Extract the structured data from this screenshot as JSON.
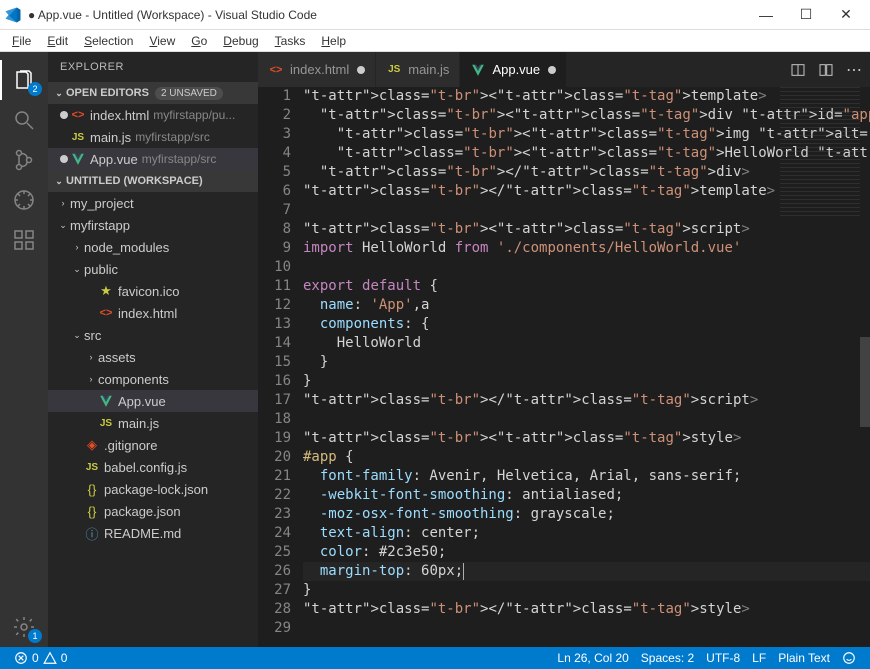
{
  "window": {
    "title": "● App.vue - Untitled (Workspace) - Visual Studio Code"
  },
  "menu": [
    "File",
    "Edit",
    "Selection",
    "View",
    "Go",
    "Debug",
    "Tasks",
    "Help"
  ],
  "activity_badges": {
    "explorer": "2",
    "settings": "1"
  },
  "sidebar": {
    "title": "EXPLORER",
    "open_editors": {
      "label": "OPEN EDITORS",
      "unsaved_badge": "2 UNSAVED",
      "items": [
        {
          "modified": true,
          "icon": "html",
          "name": "index.html",
          "desc": "myfirstapp/pu..."
        },
        {
          "modified": false,
          "icon": "js",
          "name": "main.js",
          "desc": "myfirstapp/src"
        },
        {
          "modified": true,
          "icon": "vue",
          "name": "App.vue",
          "desc": "myfirstapp/src"
        }
      ]
    },
    "workspace": {
      "label": "UNTITLED (WORKSPACE)",
      "tree": [
        {
          "depth": 0,
          "tw": "›",
          "icon": "",
          "name": "my_project"
        },
        {
          "depth": 0,
          "tw": "⌄",
          "icon": "",
          "name": "myfirstapp"
        },
        {
          "depth": 1,
          "tw": "›",
          "icon": "",
          "name": "node_modules"
        },
        {
          "depth": 1,
          "tw": "⌄",
          "icon": "",
          "name": "public"
        },
        {
          "depth": 2,
          "tw": "",
          "icon": "star",
          "name": "favicon.ico"
        },
        {
          "depth": 2,
          "tw": "",
          "icon": "html",
          "name": "index.html"
        },
        {
          "depth": 1,
          "tw": "⌄",
          "icon": "",
          "name": "src"
        },
        {
          "depth": 2,
          "tw": "›",
          "icon": "",
          "name": "assets"
        },
        {
          "depth": 2,
          "tw": "›",
          "icon": "",
          "name": "components"
        },
        {
          "depth": 2,
          "tw": "",
          "icon": "vue",
          "name": "App.vue",
          "selected": true
        },
        {
          "depth": 2,
          "tw": "",
          "icon": "js",
          "name": "main.js"
        },
        {
          "depth": 1,
          "tw": "",
          "icon": "git",
          "name": ".gitignore"
        },
        {
          "depth": 1,
          "tw": "",
          "icon": "js",
          "name": "babel.config.js"
        },
        {
          "depth": 1,
          "tw": "",
          "icon": "json",
          "name": "package-lock.json"
        },
        {
          "depth": 1,
          "tw": "",
          "icon": "json",
          "name": "package.json"
        },
        {
          "depth": 1,
          "tw": "",
          "icon": "info",
          "name": "README.md"
        }
      ]
    }
  },
  "tabs": [
    {
      "icon": "html",
      "name": "index.html",
      "modified": true,
      "active": false
    },
    {
      "icon": "js",
      "name": "main.js",
      "modified": false,
      "active": false
    },
    {
      "icon": "vue",
      "name": "App.vue",
      "modified": true,
      "active": true
    }
  ],
  "code_lines": [
    "<template>",
    "  <div id=\"app\">",
    "    <img alt=\"Vue logo\" src=\"./assets/logo.png\">",
    "    <HelloWorld msg=\"Welcome to Your Vue.js App\"/>",
    "  </div>",
    "</template>",
    "",
    "<script>",
    "import HelloWorld from './components/HelloWorld.vue'",
    "",
    "export default {",
    "  name: 'App',a",
    "  components: {",
    "    HelloWorld",
    "  }",
    "}",
    "</script>",
    "",
    "<style>",
    "#app {",
    "  font-family: Avenir, Helvetica, Arial, sans-serif;",
    "  -webkit-font-smoothing: antialiased;",
    "  -moz-osx-font-smoothing: grayscale;",
    "  text-align: center;",
    "  color: #2c3e50;",
    "  margin-top: 60px;",
    "}",
    "</style>",
    ""
  ],
  "cursor": {
    "line": 26,
    "col": 20
  },
  "status": {
    "errors": "0",
    "warnings": "0",
    "pos": "Ln 26, Col 20",
    "spaces": "Spaces: 2",
    "encoding": "UTF-8",
    "eol": "LF",
    "lang": "Plain Text"
  }
}
